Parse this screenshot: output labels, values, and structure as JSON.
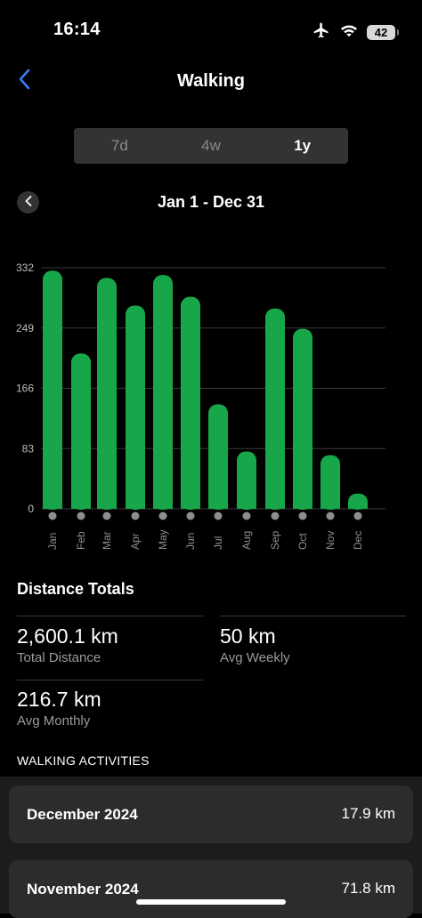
{
  "status_bar": {
    "time": "16:14",
    "battery": "42",
    "icons": [
      "airplane-icon",
      "wifi-icon",
      "battery-icon"
    ]
  },
  "nav": {
    "back_icon": "chevron-left-icon",
    "title": "Walking"
  },
  "segments": [
    {
      "label": "7d",
      "active": false
    },
    {
      "label": "4w",
      "active": false
    },
    {
      "label": "1y",
      "active": true
    }
  ],
  "range": {
    "prev_icon": "chevron-left-icon",
    "label": "Jan 1 - Dec 31"
  },
  "chart_data": {
    "type": "bar",
    "categories": [
      "Jan",
      "Feb",
      "Mar",
      "Apr",
      "May",
      "Jun",
      "Jul",
      "Aug",
      "Sep",
      "Oct",
      "Nov",
      "Dec"
    ],
    "values": [
      328,
      214,
      318,
      280,
      322,
      292,
      144,
      79,
      276,
      248,
      74,
      21
    ],
    "yticks": [
      0,
      83,
      166,
      249,
      332
    ],
    "ylim": [
      0,
      332
    ],
    "bar_color": "#17a74a",
    "grid": true,
    "marker_color": "#8e8e8e"
  },
  "totals": {
    "title": "Distance Totals",
    "stats": [
      {
        "value": "2,600.1 km",
        "label": "Total Distance"
      },
      {
        "value": "50 km",
        "label": "Avg Weekly"
      },
      {
        "value": "216.7 km",
        "label": "Avg Monthly"
      }
    ]
  },
  "activities": {
    "header": "WALKING ACTIVITIES",
    "items": [
      {
        "month": "December 2024",
        "distance": "17.9 km"
      },
      {
        "month": "November 2024",
        "distance": "71.8 km"
      }
    ]
  },
  "colors": {
    "accent_blue": "#3d7bf6",
    "bar_green": "#17a74a",
    "background": "#000000",
    "card": "#2c2c2e"
  }
}
